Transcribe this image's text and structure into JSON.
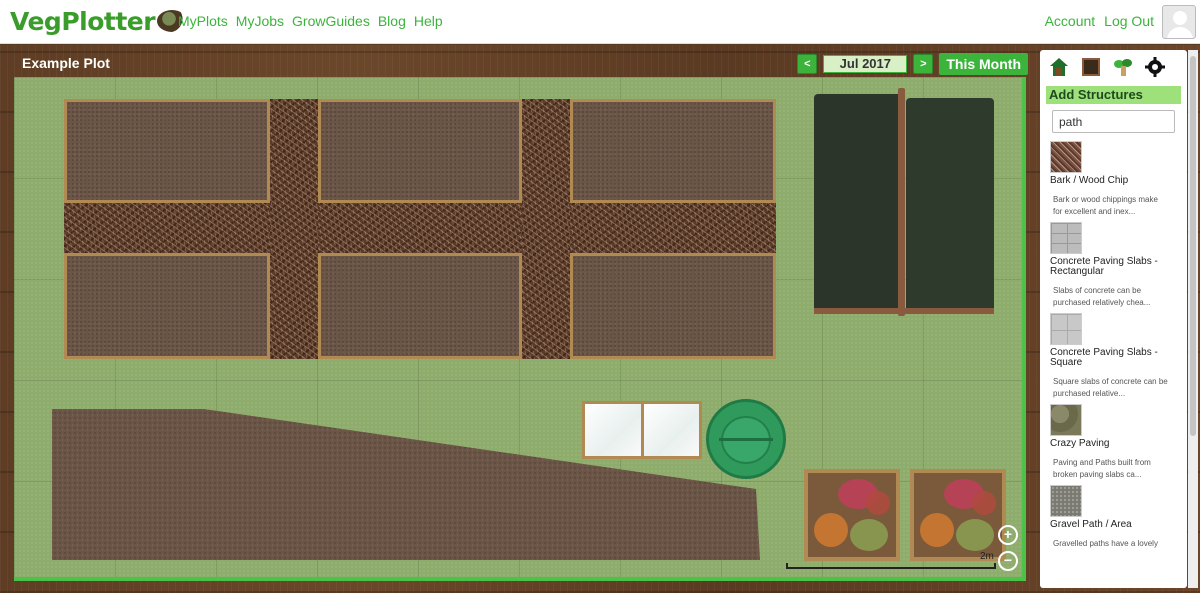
{
  "app": {
    "logo_text": "VegPlotter",
    "nav": [
      "MyPlots",
      "MyJobs",
      "GrowGuides",
      "Blog",
      "Help"
    ],
    "account": [
      "Account",
      "Log Out"
    ]
  },
  "plot": {
    "title": "Example Plot",
    "date": "Jul 2017",
    "prev_label": "<",
    "next_label": ">",
    "this_month_label": "This Month",
    "scale_label": "2m",
    "zoom_in": "+",
    "zoom_out": "−"
  },
  "panel": {
    "icons": [
      "house-icon",
      "bed-icon",
      "plant-icon",
      "gear-icon"
    ],
    "heading": "Add Structures",
    "search_value": "path",
    "items": [
      {
        "title": "Bark / Wood Chip",
        "desc": "Bark or wood chippings make for excellent and inex..."
      },
      {
        "title": "Concrete Paving Slabs - Rectangular",
        "desc": "Slabs of concrete can be purchased relatively chea..."
      },
      {
        "title": "Concrete Paving Slabs - Square",
        "desc": "Square slabs of concrete can be purchased relative..."
      },
      {
        "title": "Crazy Paving",
        "desc": "Paving and Paths built from broken paving slabs ca..."
      },
      {
        "title": "Gravel Path / Area",
        "desc": "Gravelled paths have a lovely"
      }
    ]
  },
  "colors": {
    "accent": "#3cb43c",
    "grass": "#8eac6c",
    "bed_border": "#b08a52",
    "wood": "#5e3d24"
  }
}
